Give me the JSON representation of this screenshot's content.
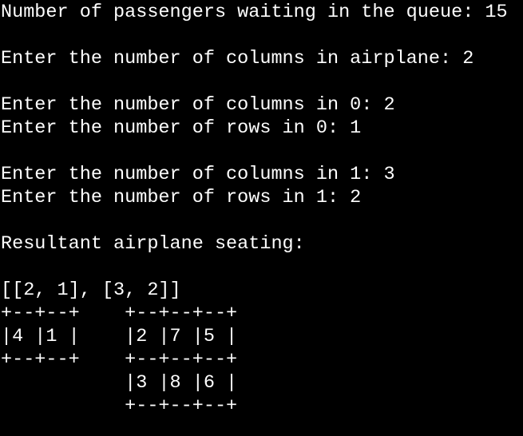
{
  "terminal": {
    "lines": [
      "Number of passengers waiting in the queue: 15",
      "",
      "Enter the number of columns in airplane: 2",
      "",
      "Enter the number of columns in 0: 2",
      "Enter the number of rows in 0: 1",
      "",
      "Enter the number of columns in 1: 3",
      "Enter the number of rows in 1: 2",
      "",
      "Resultant airplane seating:",
      "",
      "[[2, 1], [3, 2]]",
      "+--+--+    +--+--+--+",
      "|4 |1 |    |2 |7 |5 |",
      "+--+--+    +--+--+--+",
      "           |3 |8 |6 |",
      "           +--+--+--+"
    ]
  },
  "colors": {
    "background": "#000000",
    "text": "#ffffff"
  }
}
